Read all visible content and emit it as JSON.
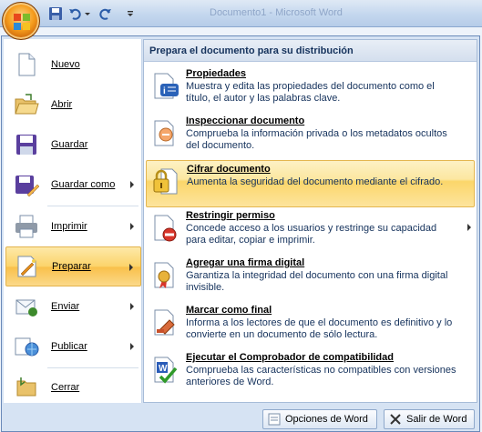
{
  "title_ghost": "Documento1 - Microsoft Word",
  "quick_access": [
    "save-icon",
    "undo-icon",
    "redo-icon",
    "customize-icon"
  ],
  "left_menu": [
    {
      "label": "Nuevo",
      "icon": "new-document-icon",
      "arrow": false
    },
    {
      "label": "Abrir",
      "icon": "open-folder-icon",
      "arrow": false
    },
    {
      "label": "Guardar",
      "icon": "save-icon",
      "arrow": false
    },
    {
      "label": "Guardar como",
      "icon": "save-as-icon",
      "arrow": true
    },
    {
      "label": "Imprimir",
      "icon": "printer-icon",
      "arrow": true
    },
    {
      "label": "Preparar",
      "icon": "prepare-icon",
      "arrow": true,
      "active": true
    },
    {
      "label": "Enviar",
      "icon": "send-icon",
      "arrow": true
    },
    {
      "label": "Publicar",
      "icon": "publish-icon",
      "arrow": true
    },
    {
      "label": "Cerrar",
      "icon": "close-document-icon",
      "arrow": false
    }
  ],
  "right_panel": {
    "header": "Prepara el documento para su distribución",
    "items": [
      {
        "title": "Propiedades",
        "desc": "Muestra y edita las propiedades del documento como el título, el autor y las palabras clave.",
        "icon": "properties-icon"
      },
      {
        "title": "Inspeccionar documento",
        "desc": "Comprueba la información privada o los metadatos ocultos del documento.",
        "icon": "inspect-document-icon"
      },
      {
        "title": "Cifrar documento",
        "desc": "Aumenta la seguridad del documento mediante el cifrado.",
        "icon": "encrypt-lock-icon",
        "active": true
      },
      {
        "title": "Restringir permiso",
        "desc": "Concede acceso a los usuarios y restringe su capacidad para editar, copiar e imprimir.",
        "icon": "restrict-permission-icon",
        "arrow": true
      },
      {
        "title": "Agregar una firma digital",
        "desc": "Garantiza la integridad del documento con una firma digital invisible.",
        "icon": "digital-signature-icon"
      },
      {
        "title": "Marcar como final",
        "desc": "Informa a los lectores de que el documento es definitivo y lo convierte en un documento de sólo lectura.",
        "icon": "mark-final-icon"
      },
      {
        "title": "Ejecutar el Comprobador de compatibilidad",
        "desc": "Comprueba las características no compatibles con versiones anteriores de Word.",
        "icon": "compatibility-checker-icon"
      }
    ]
  },
  "bottom": {
    "options_label": "Opciones de Word",
    "exit_label": "Salir de Word"
  }
}
